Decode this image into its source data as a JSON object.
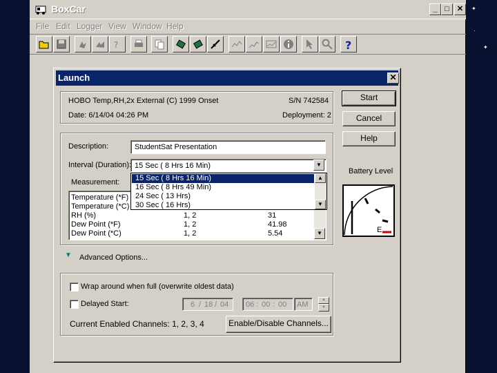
{
  "app": {
    "title": "BoxCar",
    "menu": [
      "File",
      "Edit",
      "Logger",
      "View",
      "Window",
      "Help"
    ],
    "window_controls": {
      "minimize": "_",
      "maximize": "□",
      "close": "✕"
    }
  },
  "dialog": {
    "title": "Launch",
    "close": "✕",
    "info": {
      "device": "HOBO Temp,RH,2x External (C) 1999 Onset",
      "serial": "S/N 742584",
      "date": "Date:  6/14/04 04:26 PM",
      "deployment": "Deployment: 2"
    },
    "description_label": "Description:",
    "description_value": "StudentSat Presentation",
    "interval_label": "Interval (Duration):",
    "interval_value": "15 Sec ( 8 Hrs 16 Min)",
    "interval_options": [
      "15 Sec ( 8 Hrs 16 Min)",
      "16 Sec ( 8 Hrs 49 Min)",
      "24 Sec ( 13 Hrs)",
      "30 Sec ( 16 Hrs)"
    ],
    "measurement_label": "Measurement:",
    "measurements": [
      {
        "name": "Temperature (*F)",
        "channels": "",
        "value": ""
      },
      {
        "name": "Temperature (*C)",
        "channels": "",
        "value": ""
      },
      {
        "name": "RH (%)",
        "channels": "1, 2",
        "value": "31"
      },
      {
        "name": "Dew Point (*F)",
        "channels": "1, 2",
        "value": "41.98"
      },
      {
        "name": "Dew Point (*C)",
        "channels": "1, 2",
        "value": "5.54"
      }
    ],
    "advanced_options": "Advanced Options...",
    "wrap_around": "Wrap around when full (overwrite oldest data)",
    "delayed_start": "Delayed Start:",
    "delayed_date": {
      "month": "6",
      "day": "18",
      "year": "04"
    },
    "delayed_time": {
      "hour": "06",
      "minute": "00",
      "second": "00",
      "ampm": "AM"
    },
    "enabled_channels": "Current Enabled Channels:  1, 2, 3, 4",
    "enable_disable_button": "Enable/Disable Channels...",
    "buttons": {
      "start": "Start",
      "cancel": "Cancel",
      "help": "Help"
    },
    "battery_label": "Battery Level",
    "battery_gauge_label": "E"
  },
  "colors": {
    "titlebar_active": "#0a246a",
    "window_face": "#d4d0c8",
    "battery_empty_mark": "#cc0000"
  }
}
